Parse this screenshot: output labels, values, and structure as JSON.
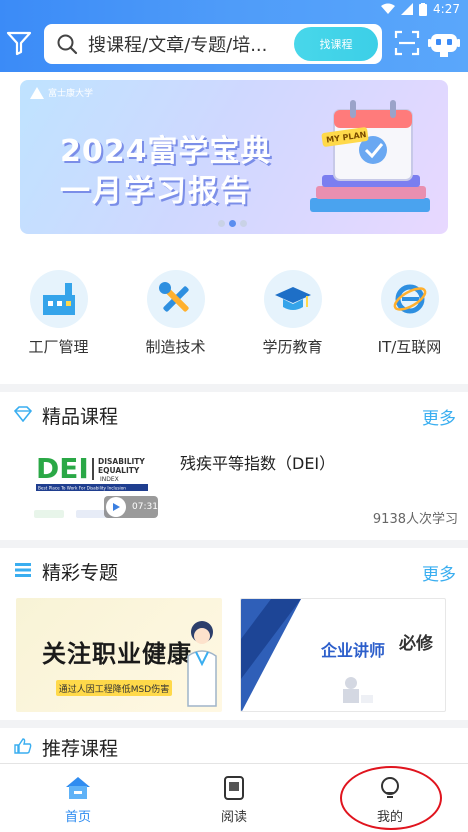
{
  "status_bar": {
    "time": "4:27"
  },
  "header": {
    "search_placeholder": "搜课程/文章/专题/培...",
    "search_button": "找课程"
  },
  "banner": {
    "logo_text": "富士康大学",
    "line1": "2024富学宝典",
    "line2": "一月学习报告",
    "badge": "MY PLAN"
  },
  "categories": [
    {
      "label": "工厂管理",
      "icon": "factory-icon"
    },
    {
      "label": "制造技术",
      "icon": "tools-icon"
    },
    {
      "label": "学历教育",
      "icon": "graduation-cap-icon"
    },
    {
      "label": "IT/互联网",
      "icon": "internet-explorer-icon"
    }
  ],
  "premium": {
    "title": "精品课程",
    "more": "更多",
    "course": {
      "title": "残疾平等指数（DEI）",
      "thumb_brand": "DEI",
      "thumb_line1": "DISABILITY",
      "thumb_line2": "EQUALITY",
      "thumb_line3": "INDEX",
      "thumb_tagline": "Best Place To Work For Disability Inclusion",
      "duration": "07:31",
      "learners": "9138人次学习"
    }
  },
  "topics": {
    "title": "精彩专题",
    "more": "更多",
    "items": [
      {
        "title": "关注职业健康",
        "subtitle": "通过人因工程降低MSD伤害"
      },
      {
        "title": "企业讲师",
        "tag": "必修"
      }
    ]
  },
  "recommended": {
    "title": "推荐课程"
  },
  "bottom_nav": [
    {
      "label": "首页",
      "active": true
    },
    {
      "label": "阅读",
      "active": false
    },
    {
      "label": "我的",
      "active": false
    }
  ]
}
